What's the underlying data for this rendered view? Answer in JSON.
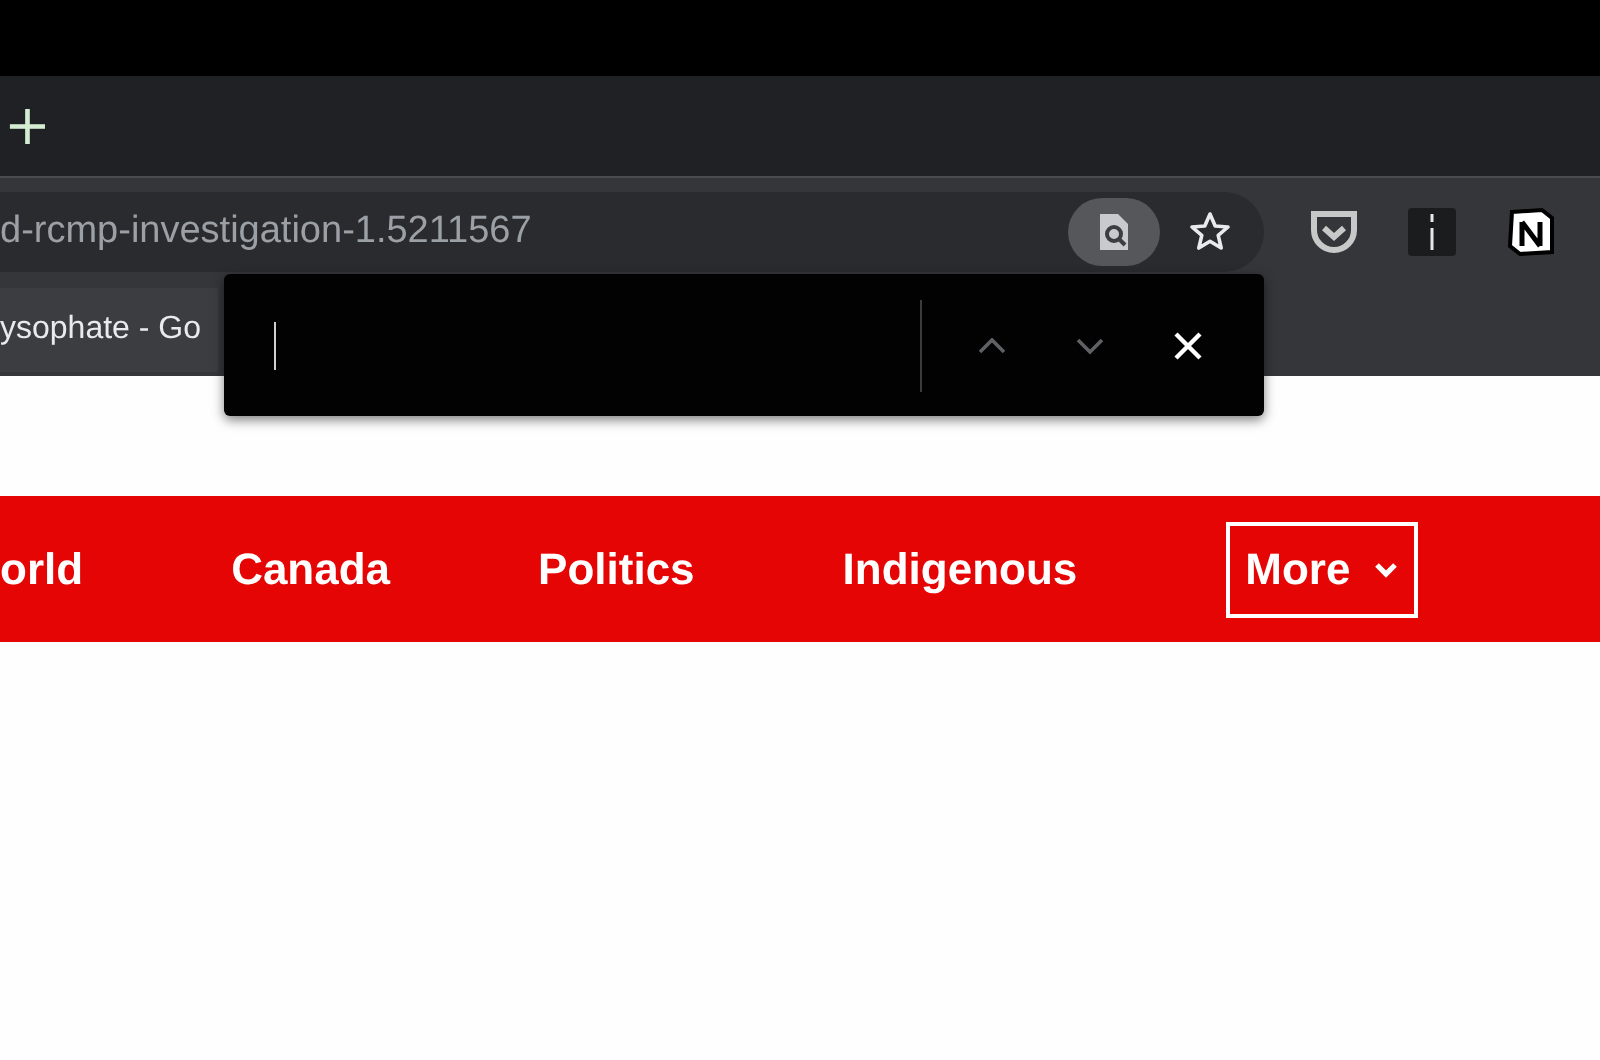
{
  "tab_strip": {
    "new_tab": "+"
  },
  "toolbar": {
    "url": "d-rcmp-investigation-1.5211567",
    "find_in_page_active": true,
    "bookmarked": false
  },
  "bookmarks_bar": {
    "items": [
      {
        "label": "ysophate - Go"
      }
    ]
  },
  "find_bar": {
    "previous_disabled": true,
    "next_disabled": true
  },
  "nav": {
    "items": [
      {
        "label": "orld",
        "kind": "link"
      },
      {
        "label": "Canada",
        "kind": "link"
      },
      {
        "label": "Politics",
        "kind": "link"
      },
      {
        "label": "Indigenous",
        "kind": "link"
      },
      {
        "label": "More",
        "kind": "menu"
      }
    ]
  }
}
